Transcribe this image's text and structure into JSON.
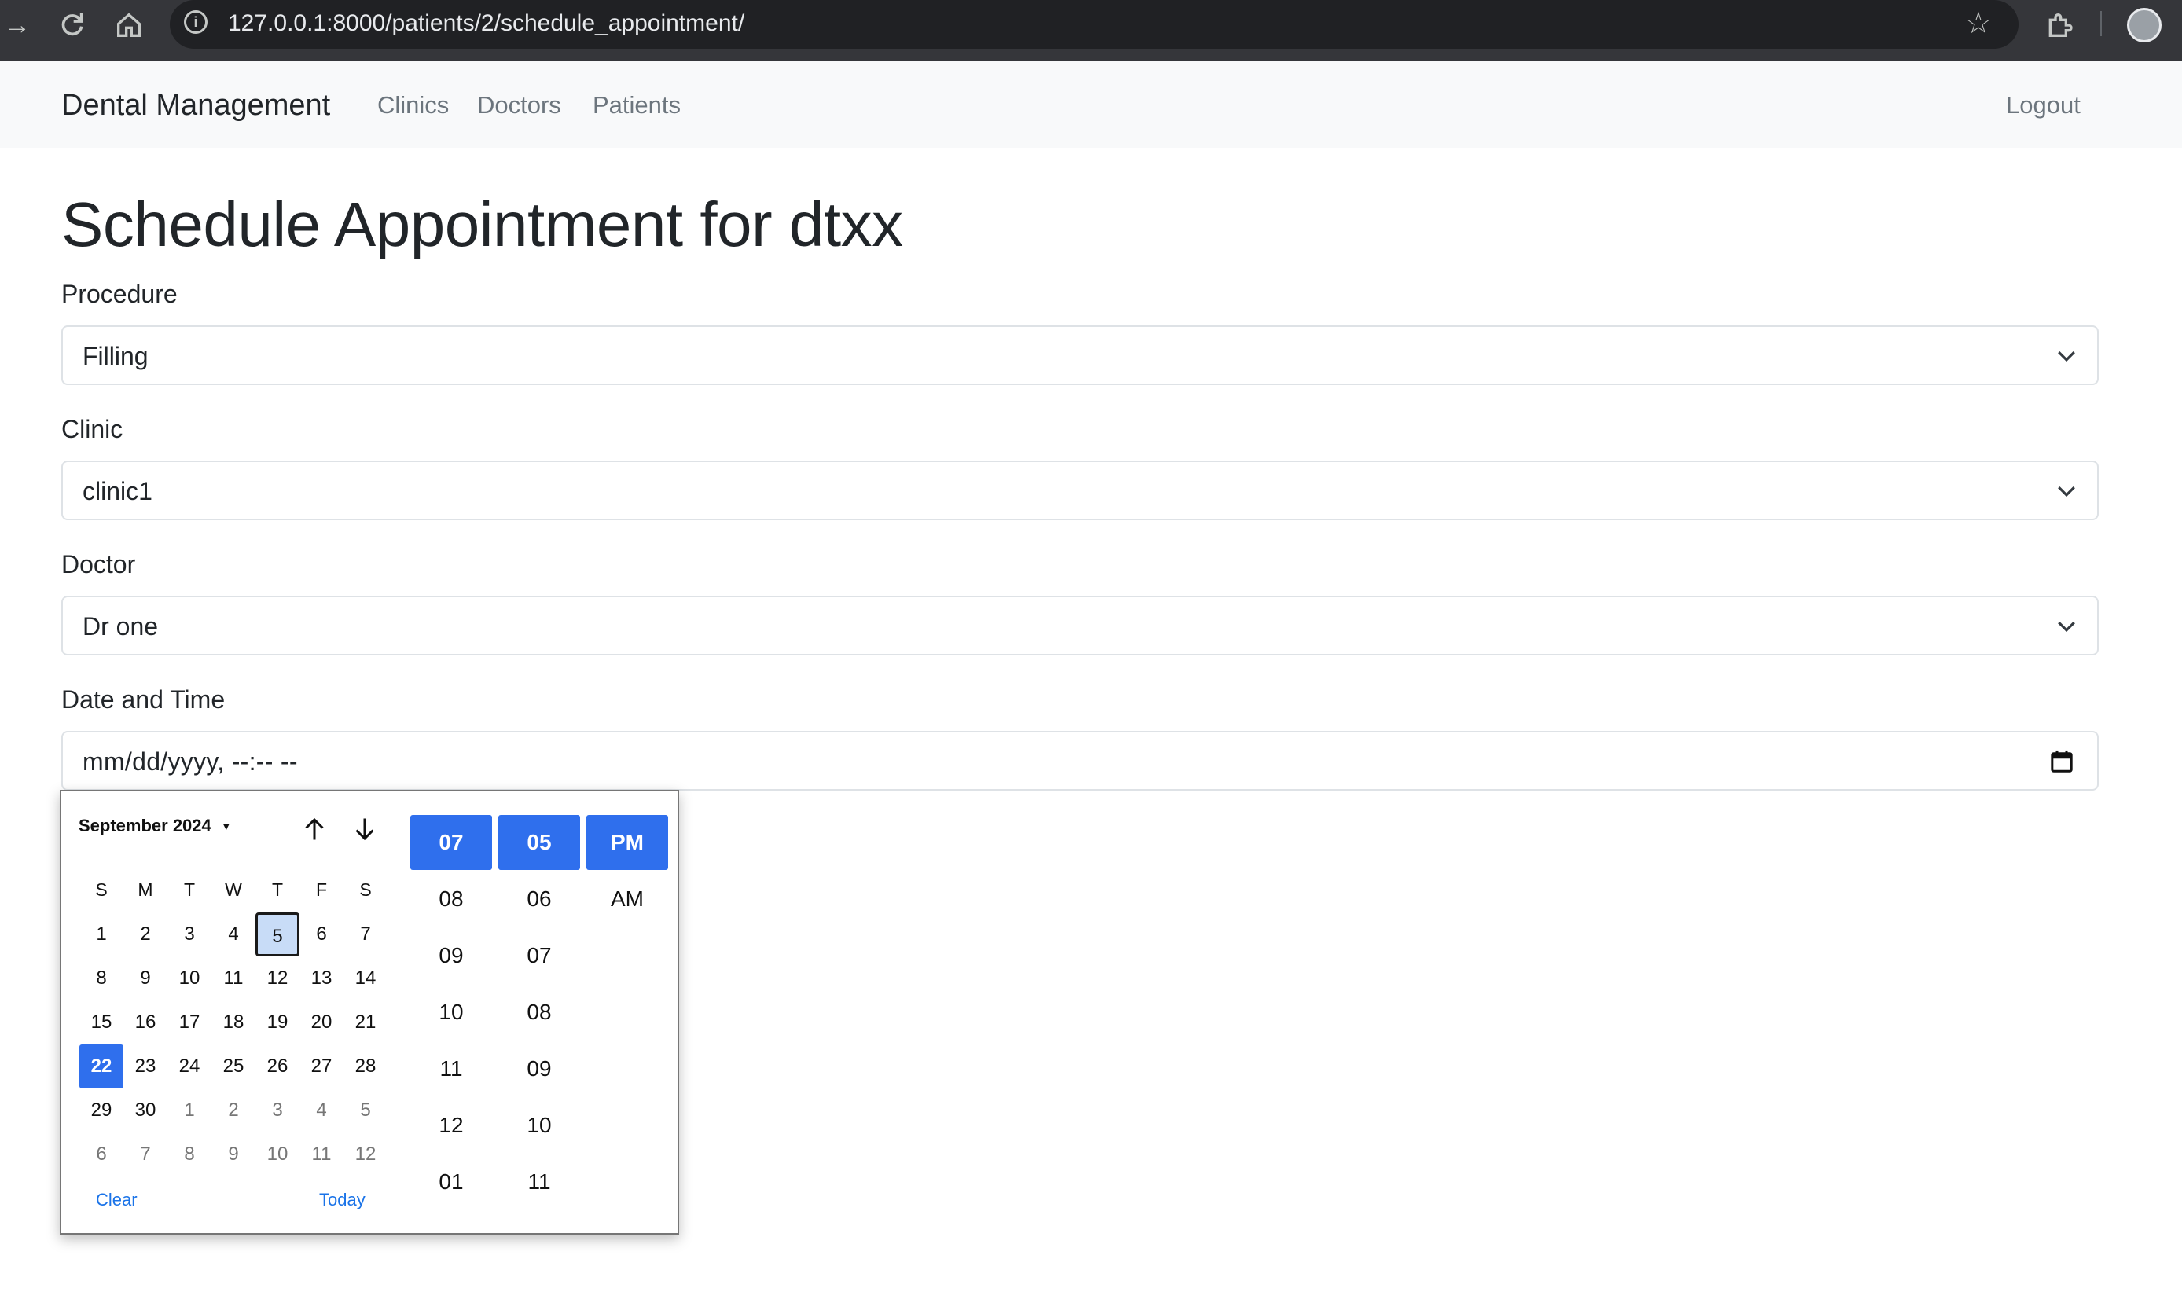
{
  "browser": {
    "url": "127.0.0.1:8000/patients/2/schedule_appointment/"
  },
  "navbar": {
    "brand": "Dental Management",
    "links": [
      "Clinics",
      "Doctors",
      "Patients"
    ],
    "logout": "Logout"
  },
  "page": {
    "title": "Schedule Appointment for dtxx"
  },
  "form": {
    "procedure": {
      "label": "Procedure",
      "value": "Filling"
    },
    "clinic": {
      "label": "Clinic",
      "value": "clinic1"
    },
    "doctor": {
      "label": "Doctor",
      "value": "Dr one"
    },
    "datetime": {
      "label": "Date and Time",
      "value": "mm/dd/yyyy, --:-- --"
    }
  },
  "datepicker": {
    "month_label": "September 2024",
    "weekdays": [
      "S",
      "M",
      "T",
      "W",
      "T",
      "F",
      "S"
    ],
    "weeks": [
      [
        "1",
        "2",
        "3",
        "4",
        "5",
        "6",
        "7"
      ],
      [
        "8",
        "9",
        "10",
        "11",
        "12",
        "13",
        "14"
      ],
      [
        "15",
        "16",
        "17",
        "18",
        "19",
        "20",
        "21"
      ],
      [
        "22",
        "23",
        "24",
        "25",
        "26",
        "27",
        "28"
      ],
      [
        "29",
        "30",
        "1",
        "2",
        "3",
        "4",
        "5"
      ],
      [
        "6",
        "7",
        "8",
        "9",
        "10",
        "11",
        "12"
      ]
    ],
    "clear_label": "Clear",
    "today_label": "Today",
    "hours": [
      "07",
      "08",
      "09",
      "10",
      "11",
      "12",
      "01"
    ],
    "minutes": [
      "05",
      "06",
      "07",
      "08",
      "09",
      "10",
      "11"
    ],
    "meridiem": [
      "PM",
      "AM"
    ],
    "selected_color": "#2f6fed",
    "today_highlight_color": "#c8dcf7"
  }
}
